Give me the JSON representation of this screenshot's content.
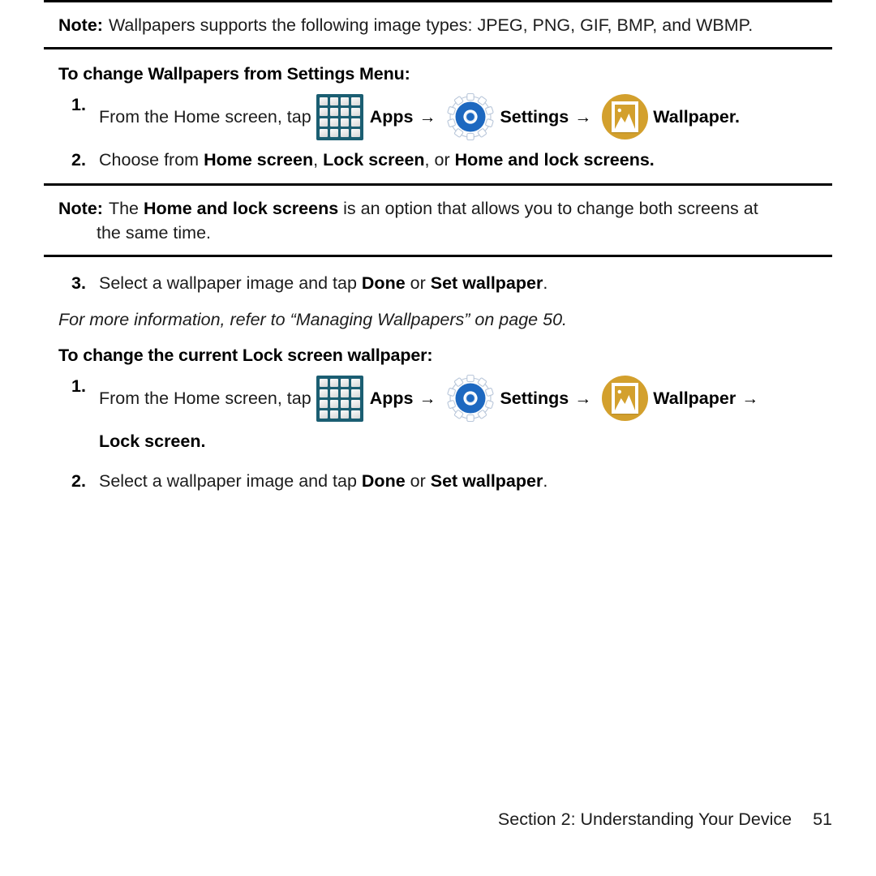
{
  "notes": {
    "label": "Note:",
    "first": "Wallpapers supports the following image types: JPEG, PNG, GIF, BMP, and WBMP.",
    "second_pre": "The ",
    "second_bold": "Home and lock screens",
    "second_post": " is an option that allows you to change both screens at",
    "second_cont": "the same time."
  },
  "section_one": {
    "heading": "To change Wallpapers from Settings Menu:",
    "steps": [
      {
        "num": "1.",
        "lead": "From the Home screen, tap",
        "apps_label": "Apps",
        "arrow": "→",
        "settings_label": "Settings",
        "wallpaper_label": "Wallpaper",
        "terminator": "."
      },
      {
        "num": "2.",
        "pre": "Choose from ",
        "opt1": "Home screen",
        "sep1": ", ",
        "opt2": "Lock screen",
        "sep2": ", or ",
        "opt3": "Home and lock screens",
        "terminator": "."
      }
    ]
  },
  "step_three": {
    "num": "3.",
    "pre": "Select a wallpaper image and tap ",
    "bold1": "Done",
    "mid": " or ",
    "bold2": "Set wallpaper",
    "terminator": "."
  },
  "cross_reference": "For more information, refer to “Managing Wallpapers” on page 50.",
  "section_two": {
    "heading": "To change the current Lock screen wallpaper:",
    "steps": [
      {
        "num": "1.",
        "lead": "From the Home screen, tap",
        "apps_label": "Apps",
        "arrow": "→",
        "settings_label": "Settings",
        "wallpaper_label": "Wallpaper",
        "sub": "Lock screen",
        "sub_terminator": "."
      },
      {
        "num": "2.",
        "pre": "Select a wallpaper image and tap ",
        "bold1": "Done",
        "mid": " or ",
        "bold2": "Set wallpaper",
        "terminator": "."
      }
    ]
  },
  "footer": {
    "section": "Section 2:  Understanding Your Device",
    "page": "51"
  },
  "icons": {
    "apps": "apps-grid-icon",
    "settings": "settings-gear-icon",
    "wallpaper": "wallpaper-picture-icon"
  },
  "colors": {
    "apps_bg": "#1b5e72",
    "gear_blue": "#1d68c0",
    "wallpaper_gold": "#d3a02d",
    "rule": "#000000"
  }
}
